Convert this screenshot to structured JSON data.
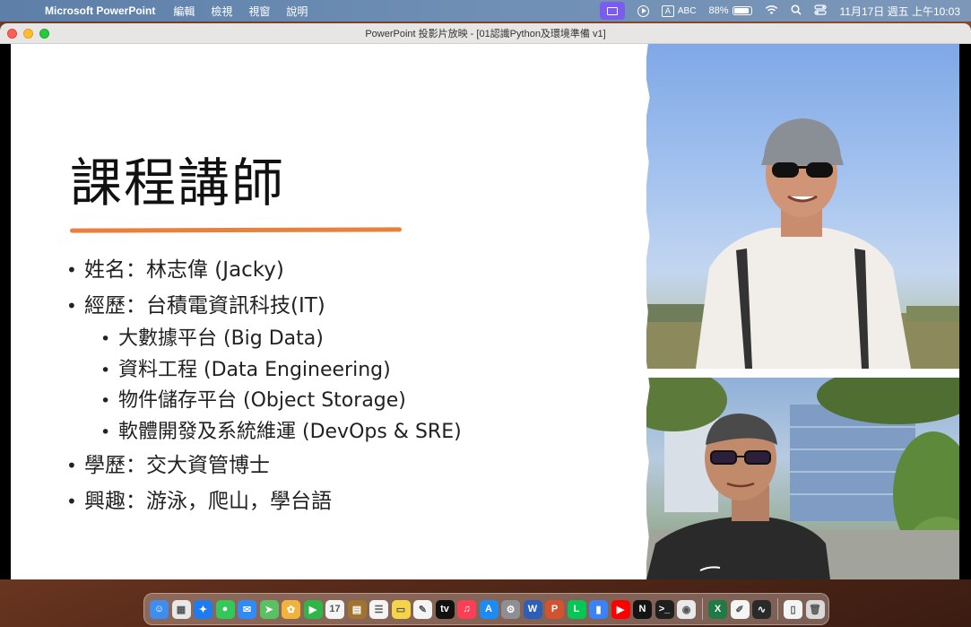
{
  "menubar": {
    "app_name": "Microsoft PowerPoint",
    "menus": [
      "編輯",
      "檢視",
      "視窗",
      "說明"
    ],
    "input_label": "ABC",
    "input_box": "A",
    "battery": "88%",
    "datetime": "11月17日 週五  上午10:03"
  },
  "window": {
    "title": "PowerPoint 投影片放映 - [01認識Python及環境準備 v1]"
  },
  "slide": {
    "title": "課程講師",
    "accent_color": "#e7823e",
    "bullets": [
      {
        "text": "姓名：林志偉 (Jacky)"
      },
      {
        "text": "經歷：台積電資訊科技(IT)"
      },
      {
        "text": "大數據平台 (Big Data)",
        "sub": true
      },
      {
        "text": "資料工程 (Data Engineering)",
        "sub": true
      },
      {
        "text": "物件儲存平台 (Object Storage)",
        "sub": true
      },
      {
        "text": "軟體開發及系統維運 (DevOps & SRE)",
        "sub": true
      },
      {
        "text": "學歷：交大資管博士"
      },
      {
        "text": "興趣：游泳，爬山，學台語"
      }
    ]
  },
  "dock": {
    "apps": [
      {
        "icon": "finder-icon",
        "color": "#3d8ef0",
        "glyph": "☺"
      },
      {
        "icon": "launchpad-icon",
        "color": "#e8e8e8",
        "glyph": "▦"
      },
      {
        "icon": "safari-icon",
        "color": "#1e7cf0",
        "glyph": "✦"
      },
      {
        "icon": "messages-icon",
        "color": "#34c759",
        "glyph": "●"
      },
      {
        "icon": "mail-icon",
        "color": "#2f8bf5",
        "glyph": "✉"
      },
      {
        "icon": "maps-icon",
        "color": "#5bbf63",
        "glyph": "➤"
      },
      {
        "icon": "photos-icon",
        "color": "#f2b33d",
        "glyph": "✿"
      },
      {
        "icon": "facetime-icon",
        "color": "#2fb54a",
        "glyph": "▶"
      },
      {
        "icon": "calendar-icon",
        "color": "#f4f4f4",
        "glyph": "17"
      },
      {
        "icon": "notes-brown-icon",
        "color": "#a0742f",
        "glyph": "▤"
      },
      {
        "icon": "reminders-icon",
        "color": "#f4f4f4",
        "glyph": "☰"
      },
      {
        "icon": "notes-icon",
        "color": "#f6d44a",
        "glyph": "▭"
      },
      {
        "icon": "freeform-icon",
        "color": "#f4f4f4",
        "glyph": "✎"
      },
      {
        "icon": "appletv-icon",
        "color": "#111111",
        "glyph": "tv"
      },
      {
        "icon": "music-icon",
        "color": "#fa3f57",
        "glyph": "♫"
      },
      {
        "icon": "appstore-icon",
        "color": "#1c8cf4",
        "glyph": "A"
      },
      {
        "icon": "system-settings-icon",
        "color": "#8e8e93",
        "glyph": "⚙"
      },
      {
        "icon": "word-icon",
        "color": "#2b5fb8",
        "glyph": "W"
      },
      {
        "icon": "powerpoint-icon",
        "color": "#d35230",
        "glyph": "P"
      },
      {
        "icon": "line-icon",
        "color": "#06c755",
        "glyph": "L"
      },
      {
        "icon": "bookmark-icon",
        "color": "#3a82f6",
        "glyph": "▮"
      },
      {
        "icon": "youtube-icon",
        "color": "#ff0000",
        "glyph": "▶"
      },
      {
        "icon": "netflix-icon",
        "color": "#141414",
        "glyph": "N"
      },
      {
        "icon": "terminal-icon",
        "color": "#1f1f1f",
        "glyph": ">_"
      },
      {
        "icon": "chrome-icon",
        "color": "#e9e9e9",
        "glyph": "◉"
      },
      {
        "icon": "excel-icon",
        "color": "#1f7a45",
        "glyph": "X"
      },
      {
        "icon": "textedit-icon",
        "color": "#f4f4f4",
        "glyph": "✐"
      },
      {
        "icon": "activity-monitor-icon",
        "color": "#2a2a2a",
        "glyph": "∿"
      },
      {
        "icon": "document-icon",
        "color": "#f4f4f4",
        "glyph": "▯"
      },
      {
        "icon": "trash-icon",
        "color": "#d9d9d9",
        "glyph": "🗑"
      }
    ]
  }
}
